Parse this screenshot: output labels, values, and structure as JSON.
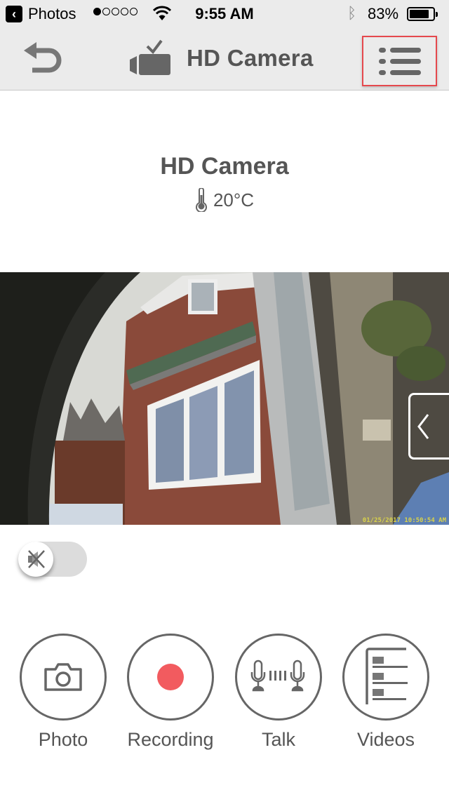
{
  "statusbar": {
    "back_app": "Photos",
    "signal_bars_on": 1,
    "signal_bars_total": 5,
    "time": "9:55 AM",
    "battery": "83%",
    "battery_level": 0.83
  },
  "navbar": {
    "title": "HD Camera",
    "back_icon": "return-arrow-icon",
    "camera_icon": "camera-online-icon",
    "menu_icon": "list-menu-icon",
    "highlight_color": "#e5484d"
  },
  "device": {
    "name": "HD Camera",
    "temperature": "20°C"
  },
  "video": {
    "timestamp": "01/25/2017  10:50:54 AM"
  },
  "controls": {
    "mute_state": "muted"
  },
  "actions": [
    {
      "label": "Photo",
      "icon": "camera-icon"
    },
    {
      "label": "Recording",
      "icon": "record-icon",
      "color": "#f25b5f"
    },
    {
      "label": "Talk",
      "icon": "intercom-icon"
    },
    {
      "label": "Videos",
      "icon": "video-list-icon"
    }
  ]
}
